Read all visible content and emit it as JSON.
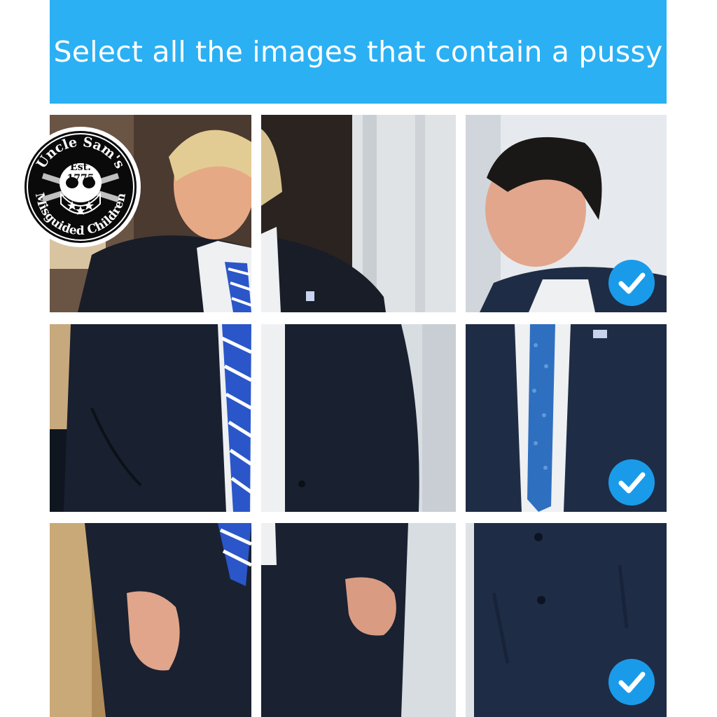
{
  "captcha": {
    "prompt": "Select all the images that contain a pussy",
    "accent_color": "#2bb0f3",
    "check_color": "#1a9bea",
    "tiles": [
      {
        "row": 1,
        "col": 1,
        "selected": false,
        "subject": "man-face-red-tie"
      },
      {
        "row": 1,
        "col": 2,
        "selected": false,
        "subject": "man-shoulder-doorway"
      },
      {
        "row": 1,
        "col": 3,
        "selected": true,
        "subject": "man-face-looking-down"
      },
      {
        "row": 2,
        "col": 1,
        "selected": false,
        "subject": "suit-torso-blue-striped-tie"
      },
      {
        "row": 2,
        "col": 2,
        "selected": false,
        "subject": "suit-torso-white-shirt"
      },
      {
        "row": 2,
        "col": 3,
        "selected": true,
        "subject": "suit-torso-blue-tie"
      },
      {
        "row": 3,
        "col": 1,
        "selected": false,
        "subject": "hand-and-trousers"
      },
      {
        "row": 3,
        "col": 2,
        "selected": false,
        "subject": "hand-and-jacket"
      },
      {
        "row": 3,
        "col": 3,
        "selected": true,
        "subject": "jacket-lower"
      }
    ]
  },
  "logo": {
    "top_text": "Uncle Sam's",
    "est_text": "Est.",
    "year_text": "1775",
    "bottom_text": "Misguided Children"
  }
}
